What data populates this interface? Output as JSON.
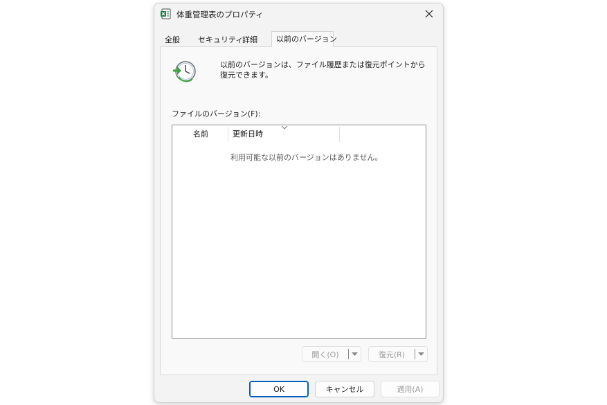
{
  "window": {
    "title": "体重管理表のプロパティ",
    "close_icon": "×"
  },
  "tabs": [
    {
      "label": "全般",
      "active": false
    },
    {
      "label": "セキュリティ",
      "active": false
    },
    {
      "label": "詳細",
      "active": false
    },
    {
      "label": "以前のバージョン",
      "active": true
    }
  ],
  "panel": {
    "info_text": "以前のバージョンは、ファイル履歴または復元ポイントから復元できます。",
    "versions_label": "ファイルのバージョン(F):",
    "columns": [
      "名前",
      "更新日時"
    ],
    "empty_message": "利用可能な以前のバージョンはありません。",
    "open_button": "開く(O)",
    "restore_button": "復元(R)"
  },
  "buttons": {
    "ok": "OK",
    "cancel": "キャンセル",
    "apply": "適用(A)"
  },
  "colors": {
    "accent": "#005fb8",
    "excel_green": "#107c41",
    "restore_green": "#3aa63a"
  }
}
